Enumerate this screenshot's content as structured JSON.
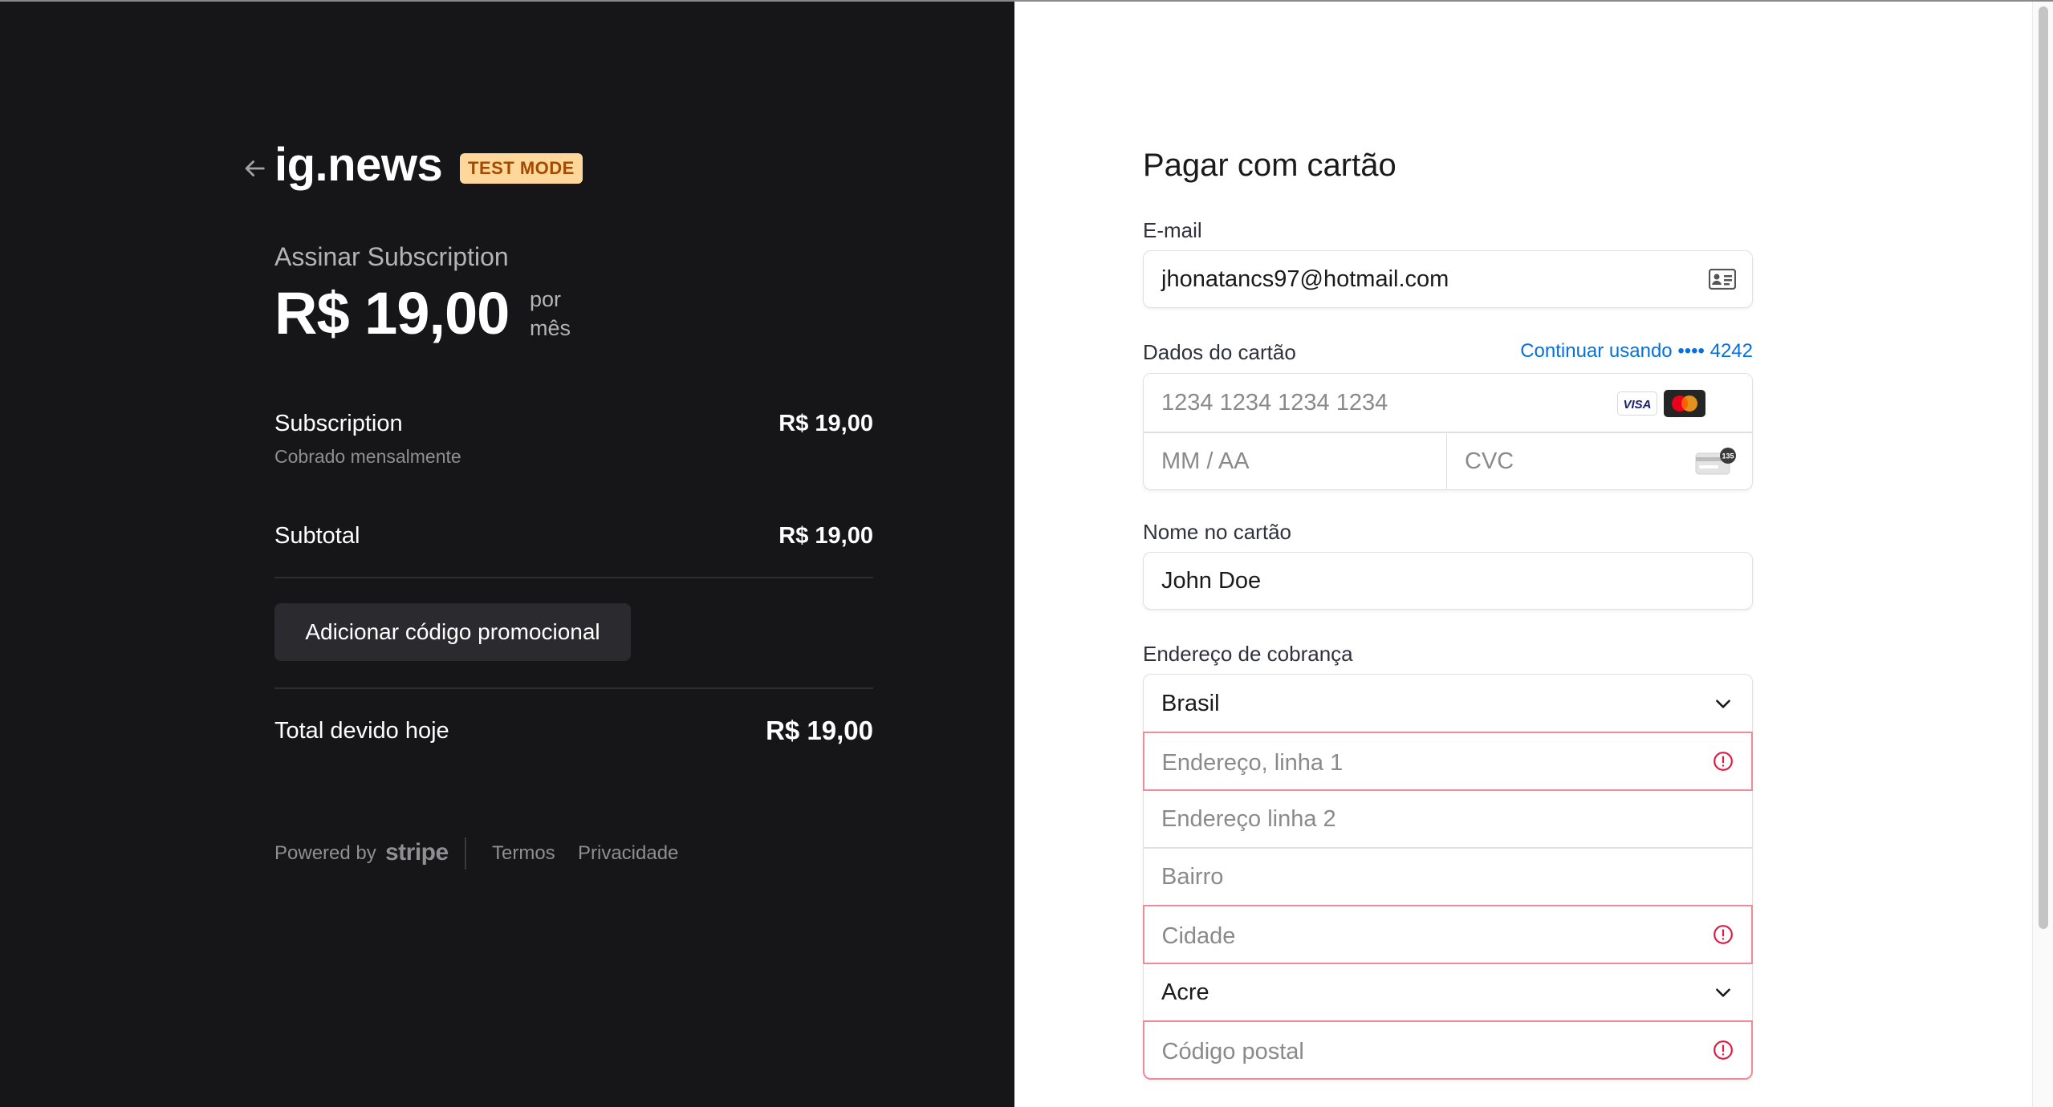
{
  "colors": {
    "left_bg": "#161618",
    "badge_bg": "#ffd79a",
    "badge_text": "#a04a02",
    "link": "#0570de",
    "error": "#df1b41"
  },
  "brand": {
    "name": "ig.news",
    "badge": "TEST MODE",
    "back_icon": "arrow-left-icon"
  },
  "summary": {
    "title": "Assinar Subscription",
    "price": "R$ 19,00",
    "period": "por mês"
  },
  "line_items": [
    {
      "label": "Subscription",
      "detail": "Cobrado mensalmente",
      "amount": "R$ 19,00"
    }
  ],
  "subtotal": {
    "label": "Subtotal",
    "amount": "R$ 19,00"
  },
  "promo_button": "Adicionar código promocional",
  "total": {
    "label": "Total devido hoje",
    "amount": "R$ 19,00"
  },
  "footer": {
    "powered_by": "Powered by",
    "stripe": "stripe",
    "terms": "Termos",
    "privacy": "Privacidade"
  },
  "form": {
    "title": "Pagar com cartão",
    "email": {
      "label": "E-mail",
      "value": "jhonatancs97@hotmail.com",
      "icon": "contact-card-icon"
    },
    "card": {
      "label": "Dados do cartão",
      "link": "Continuar usando •••• 4242",
      "number_placeholder": "1234 1234 1234 1234",
      "expiry_placeholder": "MM / AA",
      "cvc_placeholder": "CVC",
      "brands": [
        "VISA",
        "mastercard"
      ],
      "cvc_icon_text": "135"
    },
    "name": {
      "label": "Nome no cartão",
      "value": "John Doe"
    },
    "address": {
      "label": "Endereço de cobrança",
      "country": "Brasil",
      "line1_placeholder": "Endereço, linha 1",
      "line2_placeholder": "Endereço linha 2",
      "district_placeholder": "Bairro",
      "city_placeholder": "Cidade",
      "state": "Acre",
      "postal_placeholder": "Código postal"
    }
  }
}
